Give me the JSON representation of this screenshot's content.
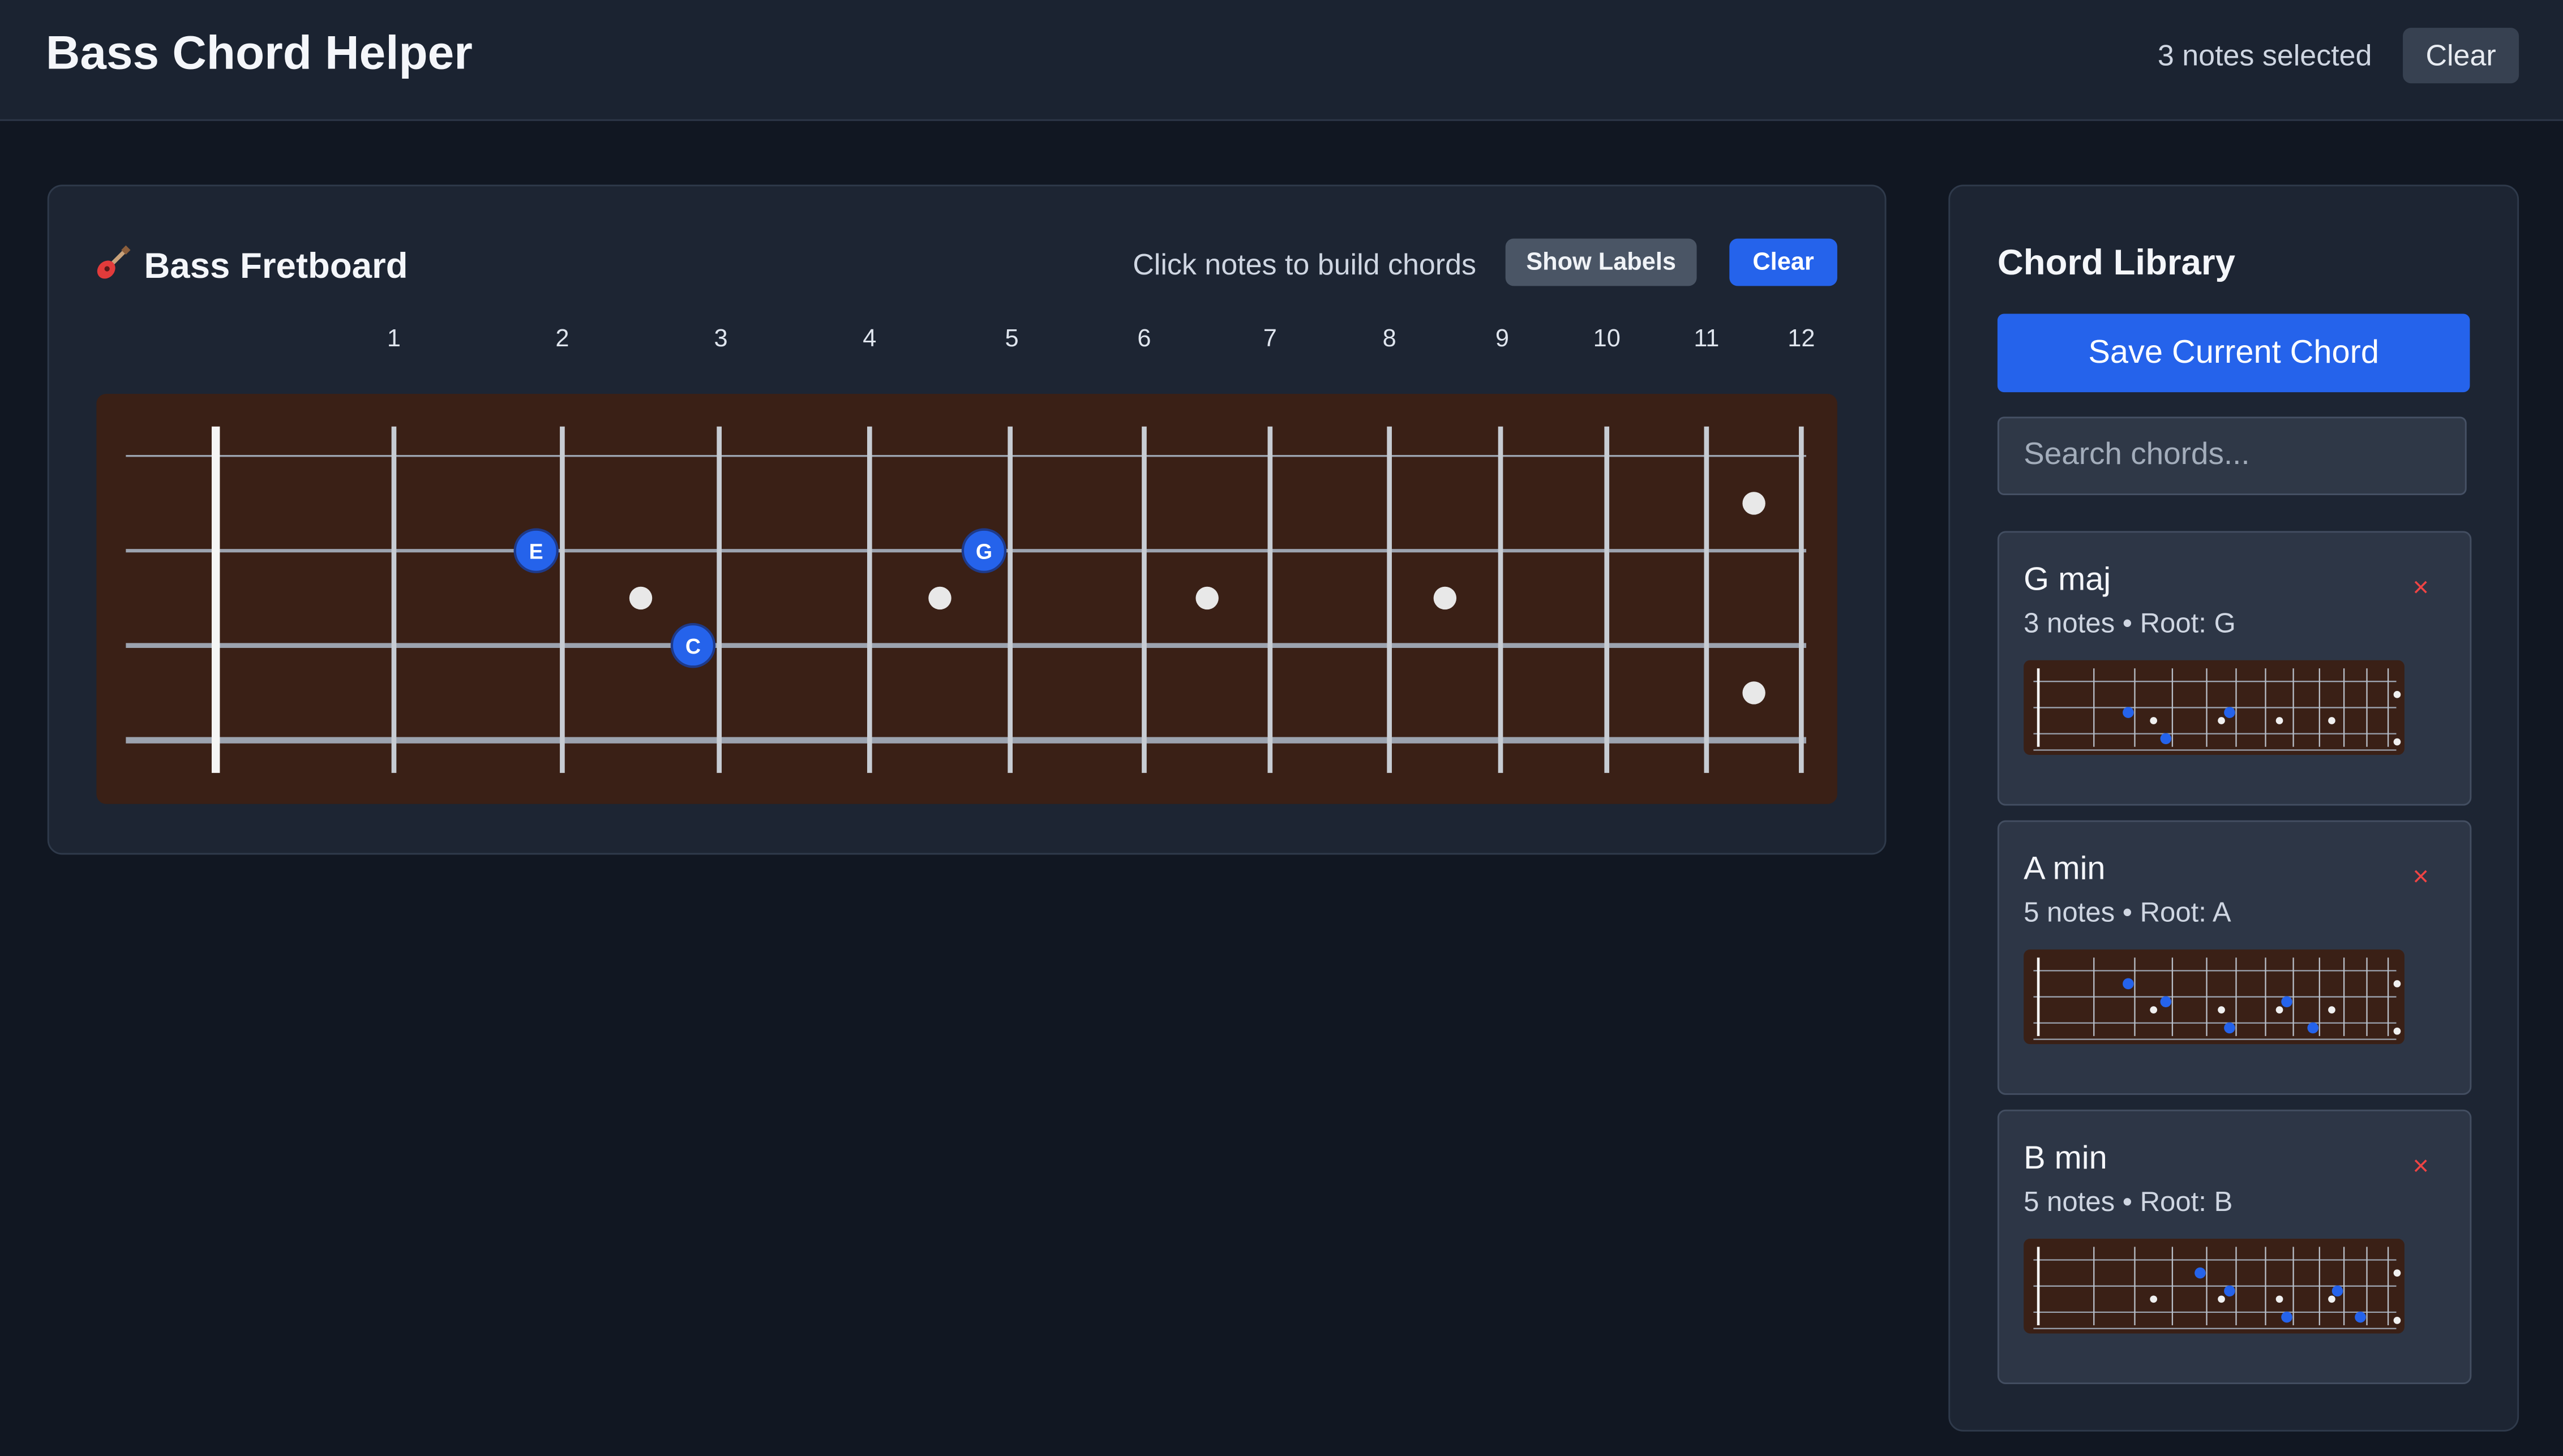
{
  "header": {
    "title": "Bass Chord Helper",
    "status": "3 notes selected",
    "clear_label": "Clear"
  },
  "fretboard": {
    "title": "Bass Fretboard",
    "title_icon": "guitar-icon",
    "hint": "Click notes to build chords",
    "show_labels_label": "Show Labels",
    "clear_label": "Clear",
    "fret_numbers": [
      "1",
      "2",
      "3",
      "4",
      "5",
      "6",
      "7",
      "8",
      "9",
      "10",
      "11",
      "12"
    ],
    "inlay_frets": [
      3,
      5,
      7,
      9
    ],
    "double_inlay_fret": 12,
    "selected_notes": [
      {
        "label": "E",
        "string": 2,
        "fret": 2
      },
      {
        "label": "G",
        "string": 2,
        "fret": 5
      },
      {
        "label": "C",
        "string": 3,
        "fret": 3
      }
    ],
    "colors": {
      "wood": "#3a2016",
      "note": "#2563eb",
      "inlay": "#e8e8e8"
    }
  },
  "library": {
    "title": "Chord Library",
    "save_label": "Save Current Chord",
    "search_placeholder": "Search chords...",
    "chords": [
      {
        "name": "G maj",
        "meta": "3 notes • Root: G",
        "delete": "×",
        "notes": [
          {
            "string": 2,
            "fret": 2
          },
          {
            "string": 2,
            "fret": 5
          },
          {
            "string": 3,
            "fret": 3
          }
        ]
      },
      {
        "name": "A min",
        "meta": "5 notes • Root: A",
        "delete": "×",
        "notes": [
          {
            "string": 1,
            "fret": 2
          },
          {
            "string": 2,
            "fret": 3
          },
          {
            "string": 3,
            "fret": 5
          },
          {
            "string": 2,
            "fret": 7
          },
          {
            "string": 3,
            "fret": 8
          }
        ]
      },
      {
        "name": "B min",
        "meta": "5 notes • Root: B",
        "delete": "×",
        "notes": [
          {
            "string": 1,
            "fret": 4
          },
          {
            "string": 2,
            "fret": 5
          },
          {
            "string": 3,
            "fret": 7
          },
          {
            "string": 2,
            "fret": 9
          },
          {
            "string": 3,
            "fret": 10
          }
        ]
      }
    ]
  }
}
